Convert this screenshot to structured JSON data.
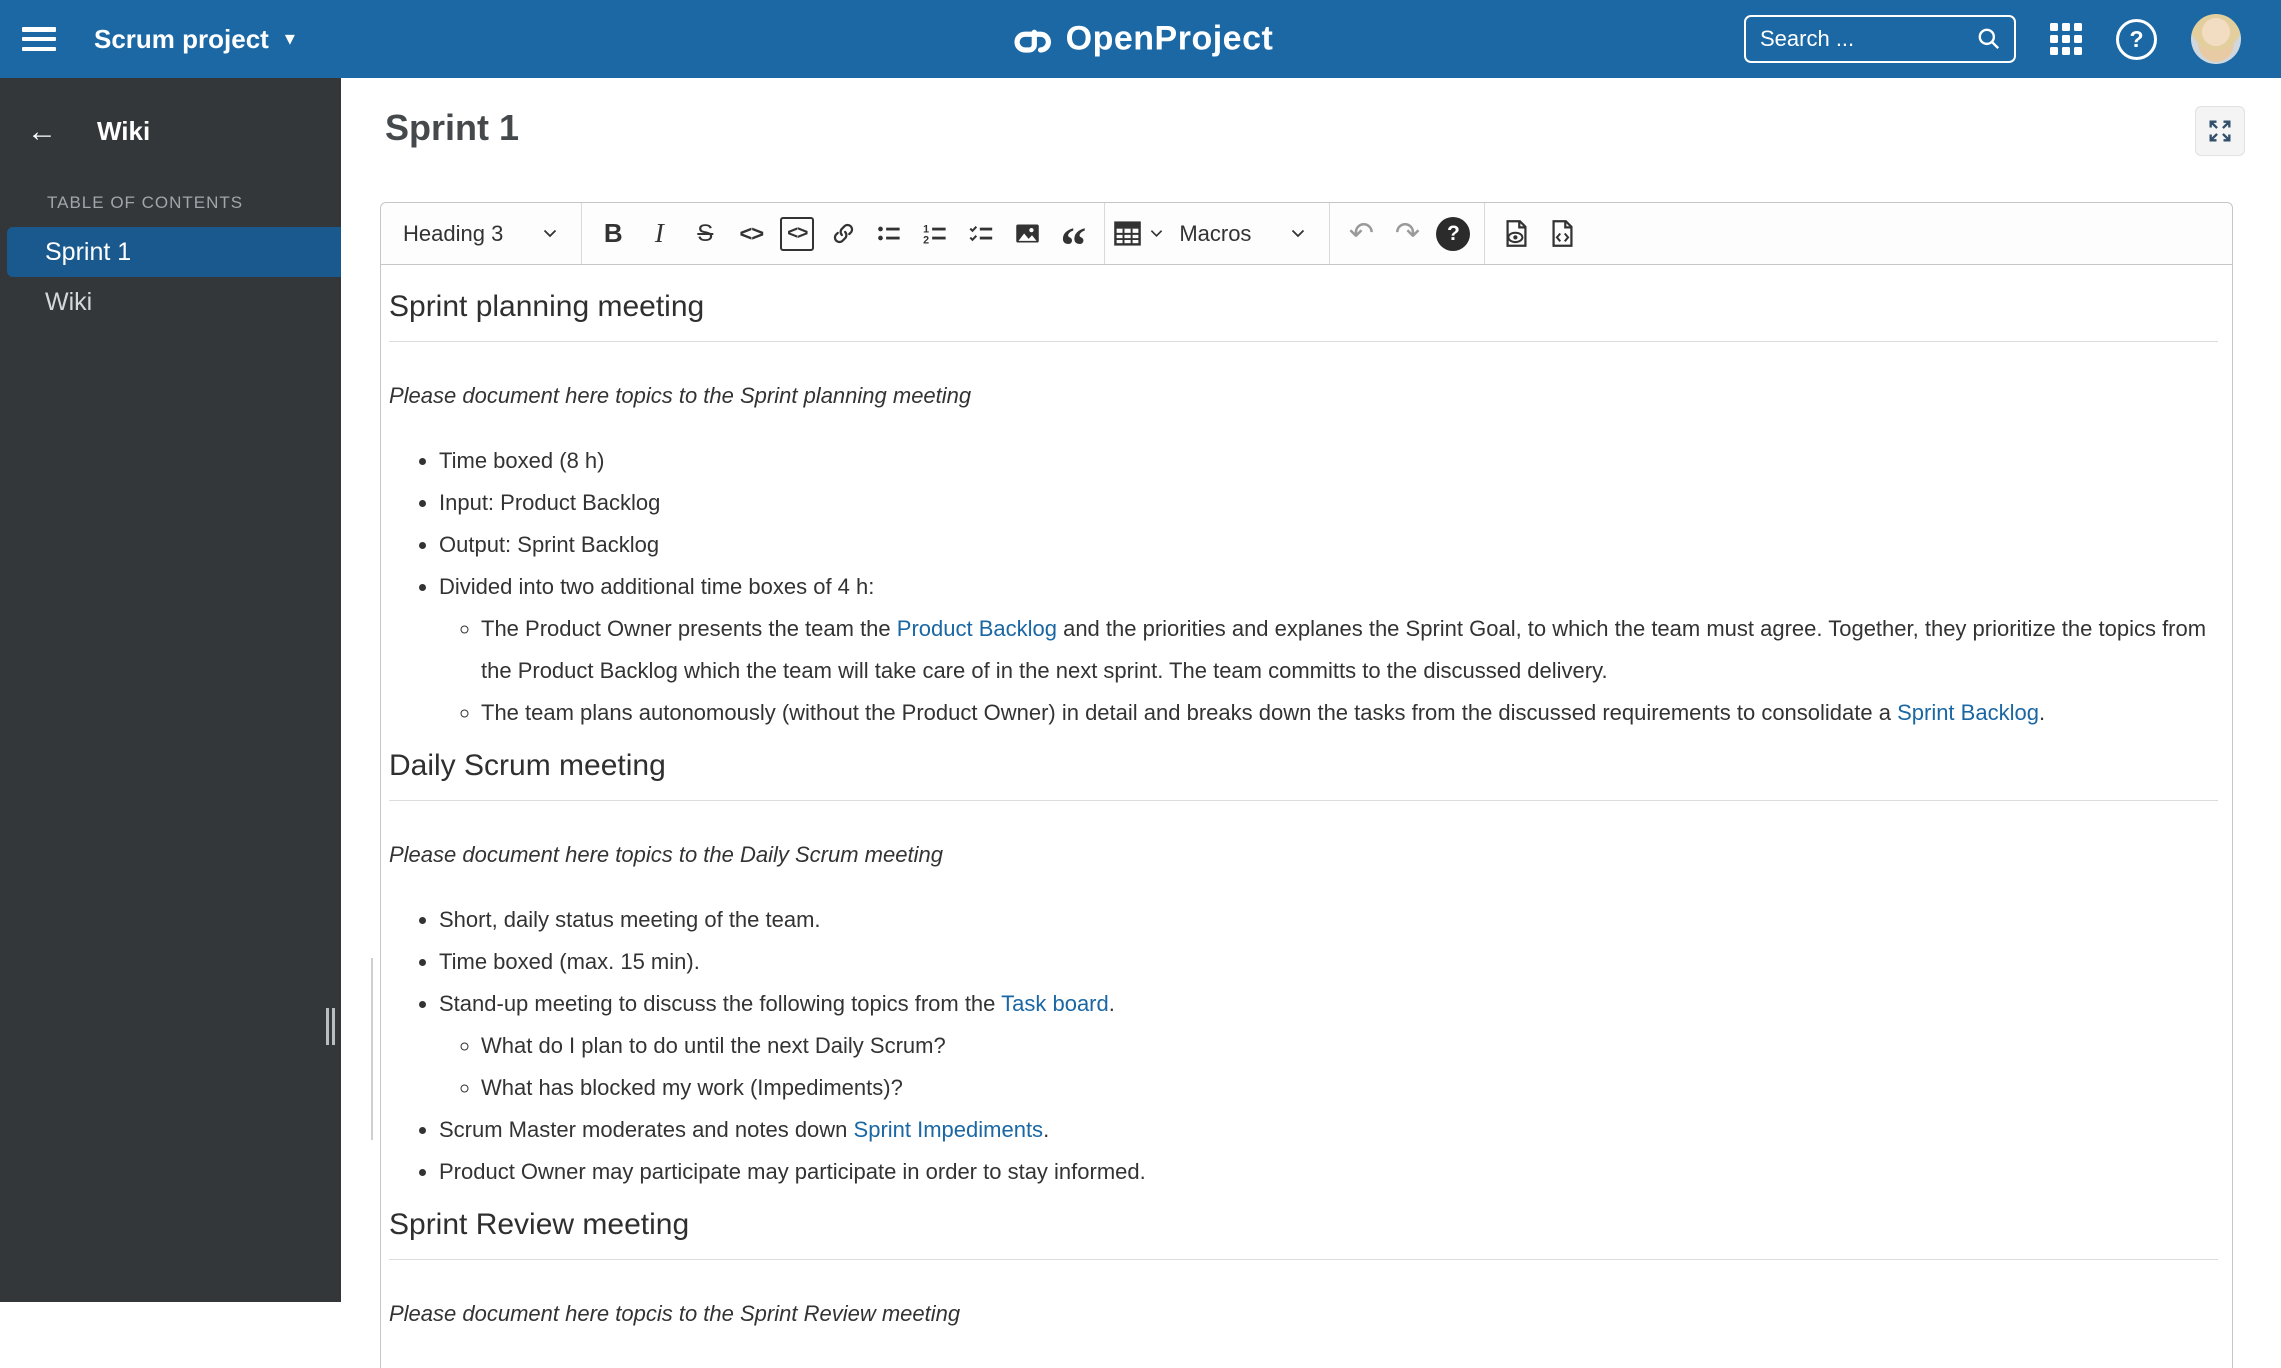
{
  "colors": {
    "header_blue": "#1b68a4",
    "sidebar_bg": "#333739",
    "sidebar_selected_bg": "#19598d",
    "link_blue": "#1a67a3",
    "text": "#333333"
  },
  "icons": {
    "back": "←",
    "caret_down": "▾",
    "undo": "↶",
    "redo": "↷",
    "help": "?"
  },
  "header": {
    "project_name": "Scrum project",
    "logo_text": "OpenProject",
    "search_placeholder": "Search ..."
  },
  "sidebar": {
    "title": "Wiki",
    "toc_label": "TABLE OF CONTENTS",
    "items": [
      {
        "label": "Sprint 1"
      },
      {
        "label": "Wiki"
      }
    ]
  },
  "page": {
    "title": "Sprint 1"
  },
  "toolbar": {
    "heading_dropdown": "Heading 3",
    "macros_label": "Macros",
    "bold": "B",
    "italic": "I",
    "strikethrough": "S",
    "inline_code": "<>",
    "code_block": "<>",
    "quote": "“"
  },
  "content": {
    "sections": [
      {
        "heading": "Sprint planning meeting",
        "intro": "Please document here topics to the Sprint planning meeting",
        "items": {
          "i1": "Time boxed (8 h)",
          "i2": "Input: Product Backlog",
          "i3": "Output: Sprint Backlog",
          "i4": "Divided into two additional time boxes of 4 h:",
          "i4c1": {
            "pre": "The Product Owner presents the team the ",
            "link": "Product Backlog",
            "post": " and the priorities and explanes the Sprint Goal, to which the team must agree. Together, they prioritize the topics from the Product Backlog which the team will take care of in the next sprint. The team committs to the discussed delivery."
          },
          "i4c2": {
            "pre": "The team plans autonomously (without the Product Owner) in detail and breaks down the tasks from the discussed requirements to consolidate a ",
            "link": "Sprint Backlog",
            "post": "."
          }
        }
      },
      {
        "heading": "Daily Scrum meeting",
        "intro": "Please document here topics to the Daily Scrum meeting",
        "items": {
          "i1": "Short, daily status meeting of the team.",
          "i2": "Time boxed (max. 15 min).",
          "i3": {
            "pre": "Stand-up meeting to discuss the following topics from the ",
            "link": "Task board",
            "post": "."
          },
          "i3c1": "What do I plan to do until the next Daily Scrum?",
          "i3c2": "What has blocked my work (Impediments)?",
          "i4": {
            "pre": "Scrum Master moderates and notes down ",
            "link": "Sprint Impediments",
            "post": "."
          },
          "i5": "Product Owner may participate may participate in order to stay informed."
        }
      },
      {
        "heading": "Sprint Review meeting",
        "intro": "Please document here topcis to the Sprint Review meeting"
      }
    ]
  }
}
